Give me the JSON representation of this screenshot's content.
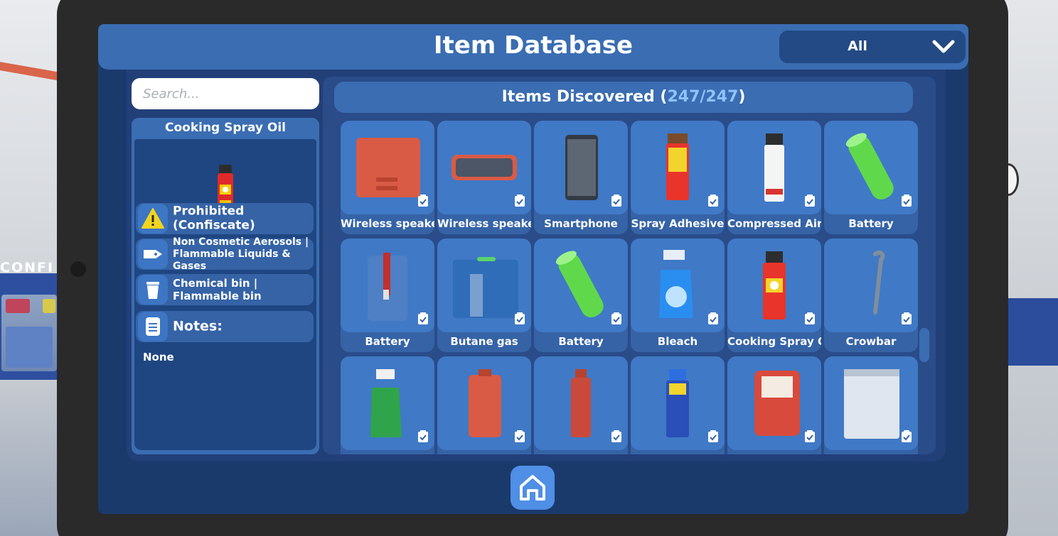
{
  "header": {
    "title": "Item Database",
    "filter_value": "All"
  },
  "search": {
    "placeholder": "Search..."
  },
  "detail": {
    "name": "Cooking Spray Oil",
    "status": "Prohibited (Confiscate)",
    "category": "Non Cosmetic Aerosols | Flammable Liquids & Gases",
    "bin": "Chemical bin | Flammable bin",
    "notes_label": "Notes:",
    "notes_value": "None"
  },
  "items_discovered": {
    "label": "Items Discovered (",
    "count": "247/247",
    "suffix": ")"
  },
  "items": [
    {
      "label": "Wireless speaker",
      "icon": "speaker-red-icon"
    },
    {
      "label": "Wireless speaker",
      "icon": "speaker-bar-icon"
    },
    {
      "label": "Smartphone",
      "icon": "smartphone-icon"
    },
    {
      "label": "Spray Adhesive",
      "icon": "spray-can-icon"
    },
    {
      "label": "Compressed Air",
      "icon": "compressed-air-can-icon"
    },
    {
      "label": "Battery",
      "icon": "battery-icon"
    },
    {
      "label": "Battery",
      "icon": "battery-pack-icon"
    },
    {
      "label": "Butane gas",
      "icon": "butane-case-icon"
    },
    {
      "label": "Battery",
      "icon": "battery-icon"
    },
    {
      "label": "Bleach",
      "icon": "spray-bottle-icon"
    },
    {
      "label": "Cooking Spray Oil",
      "icon": "cooking-spray-icon"
    },
    {
      "label": "Crowbar",
      "icon": "crowbar-icon"
    },
    {
      "label": "",
      "icon": "cleaner-spray-icon"
    },
    {
      "label": "",
      "icon": "vape-icon"
    },
    {
      "label": "",
      "icon": "red-bottle-icon"
    },
    {
      "label": "",
      "icon": "aerosol-blue-icon"
    },
    {
      "label": "",
      "icon": "flour-bag-icon"
    },
    {
      "label": "",
      "icon": "tin-can-icon"
    }
  ],
  "colors": {
    "header": "#3a6db2",
    "panel": "#223f78",
    "card": "#3563a6",
    "accent_count": "#8fc3ff",
    "warning": "#f2d51c"
  }
}
